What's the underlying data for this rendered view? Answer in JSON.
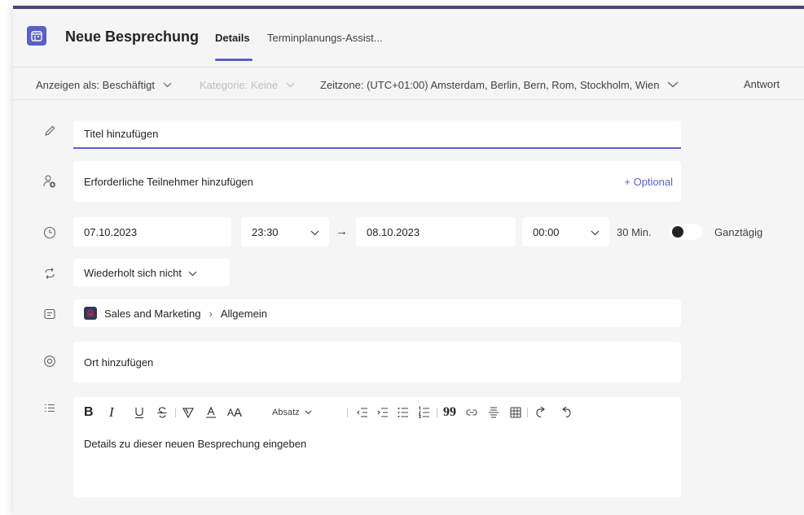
{
  "header": {
    "title": "Neue Besprechung",
    "tabs": [
      {
        "label": "Details",
        "active": true
      },
      {
        "label": "Terminplanungs-Assist..."
      }
    ]
  },
  "toolbar": {
    "show_as": "Anzeigen als: Beschäftigt",
    "category": "Kategorie: Keine",
    "timezone": "Zeitzone: (UTC+01:00) Amsterdam, Berlin, Bern, Rom, Stockholm, Wien",
    "response": "Antwort"
  },
  "form": {
    "title_placeholder": "Titel hinzufügen",
    "attendees_placeholder": "Erforderliche Teilnehmer hinzufügen",
    "optional_label": "+ Optional",
    "start_date": "07.10.2023",
    "start_time": "23:30",
    "end_date": "08.10.2023",
    "end_time": "00:00",
    "duration": "30 Min.",
    "all_day_label": "Ganztägig",
    "all_day_on": false,
    "recurrence": "Wiederholt sich nicht",
    "team": "Sales and Marketing",
    "channel": "Allgemein",
    "location_placeholder": "Ort hinzufügen"
  },
  "editor": {
    "paragraph_style": "Absatz",
    "placeholder": "Details zu dieser neuen Besprechung eingeben"
  },
  "colors": {
    "accent": "#5b5fc7",
    "frame": "#464775",
    "background": "#f5f5f5"
  },
  "icons": [
    "calendar-icon",
    "pencil-icon",
    "add-person-icon",
    "clock-icon",
    "repeat-icon",
    "channel-icon",
    "location-icon",
    "details-icon"
  ]
}
